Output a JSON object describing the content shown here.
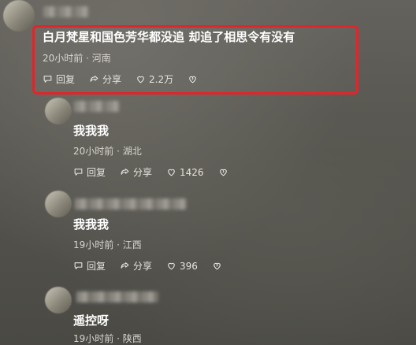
{
  "comments": [
    {
      "text": "白月梵星和国色芳华都没追 却追了相思令有没有",
      "meta": "20小时前 · 河南",
      "reply_label": "回复",
      "share_label": "分享",
      "likes": "2.2万"
    },
    {
      "text": "我我我",
      "meta": "20小时前 · 湖北",
      "reply_label": "回复",
      "share_label": "分享",
      "likes": "1426"
    },
    {
      "text": "我我我",
      "meta": "19小时前 · 江西",
      "reply_label": "回复",
      "share_label": "分享",
      "likes": "396"
    },
    {
      "text": "遥控呀",
      "meta": "19小时前 · 陕西"
    }
  ],
  "colors": {
    "highlight": "#e1252b",
    "text": "#ffffff",
    "meta": "#d9d6cf"
  },
  "icons": [
    "reply-icon",
    "share-icon",
    "like-icon",
    "dislike-icon"
  ]
}
